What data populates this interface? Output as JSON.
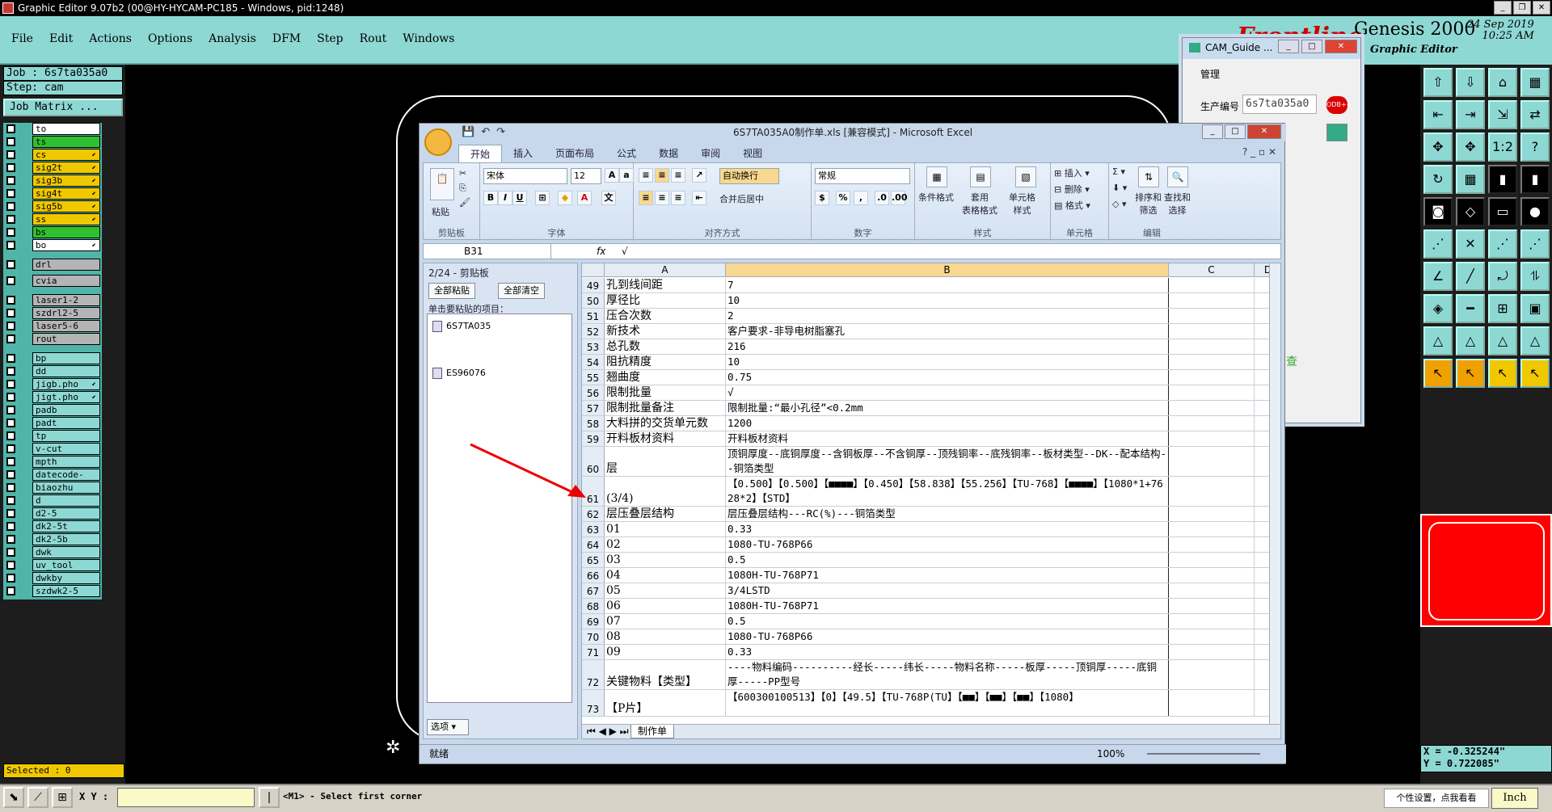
{
  "window": {
    "title": "Graphic Editor 9.07b2 (00@HY-HYCAM-PC185 - Windows, pid:1248)"
  },
  "menu": [
    "File",
    "Edit",
    "Actions",
    "Options",
    "Analysis",
    "DFM",
    "Step",
    "Rout",
    "Windows"
  ],
  "brand": {
    "frontline": "Frontline",
    "product": "Genesis 2000",
    "subtitle": "Graphic Editor",
    "date": "24 Sep 2019",
    "time": "10:25 AM"
  },
  "job": {
    "job_label": "Job : 6s7ta035a0",
    "step_label": "Step: cam",
    "matrix_button": "Job Matrix ..."
  },
  "layers": [
    {
      "name": "to",
      "color": "white",
      "arrow": ""
    },
    {
      "name": "ts",
      "color": "green",
      "arrow": ""
    },
    {
      "name": "cs",
      "color": "yellow",
      "arrow": "⬋"
    },
    {
      "name": "sig2t",
      "color": "yellow",
      "arrow": "⬋"
    },
    {
      "name": "sig3b",
      "color": "yellow",
      "arrow": "⬋"
    },
    {
      "name": "sig4t",
      "color": "yellow",
      "arrow": "⬋"
    },
    {
      "name": "sig5b",
      "color": "yellow",
      "arrow": "⬋"
    },
    {
      "name": "ss",
      "color": "yellow",
      "arrow": "⬋"
    },
    {
      "name": "bs",
      "color": "green",
      "arrow": ""
    },
    {
      "name": "bo",
      "color": "white",
      "arrow": "⬋"
    },
    {
      "name": "drl",
      "color": "grey",
      "arrow": ""
    },
    {
      "name": "cvia",
      "color": "grey",
      "arrow": ""
    },
    {
      "name": "laser1-2",
      "color": "grey",
      "arrow": ""
    },
    {
      "name": "szdrl2-5",
      "color": "grey",
      "arrow": ""
    },
    {
      "name": "laser5-6",
      "color": "grey",
      "arrow": ""
    },
    {
      "name": "rout",
      "color": "grey",
      "arrow": ""
    },
    {
      "name": "bp",
      "color": "teal",
      "arrow": ""
    },
    {
      "name": "dd",
      "color": "teal",
      "arrow": ""
    },
    {
      "name": "jigb.pho",
      "color": "teal",
      "arrow": "⬋"
    },
    {
      "name": "jigt.pho",
      "color": "teal",
      "arrow": "⬋"
    },
    {
      "name": "padb",
      "color": "teal",
      "arrow": ""
    },
    {
      "name": "padt",
      "color": "teal",
      "arrow": ""
    },
    {
      "name": "tp",
      "color": "teal",
      "arrow": ""
    },
    {
      "name": "v-cut",
      "color": "teal",
      "arrow": ""
    },
    {
      "name": "mpth",
      "color": "teal",
      "arrow": ""
    },
    {
      "name": "datecode-pte",
      "color": "teal",
      "arrow": ""
    },
    {
      "name": "biaozhu",
      "color": "teal",
      "arrow": ""
    },
    {
      "name": "d",
      "color": "teal",
      "arrow": ""
    },
    {
      "name": "d2-5",
      "color": "teal",
      "arrow": ""
    },
    {
      "name": "dk2-5t",
      "color": "teal",
      "arrow": ""
    },
    {
      "name": "dk2-5b",
      "color": "teal",
      "arrow": ""
    },
    {
      "name": "dwk",
      "color": "teal",
      "arrow": ""
    },
    {
      "name": "uv_tool",
      "color": "teal",
      "arrow": ""
    },
    {
      "name": "dwkby",
      "color": "teal",
      "arrow": ""
    },
    {
      "name": "szdwk2-5",
      "color": "teal",
      "arrow": ""
    }
  ],
  "selected": "Selected : 0",
  "status": {
    "xy_label": "X Y :",
    "xy_value": "",
    "message": "<M1> - Select first corner",
    "tip": "个性设置，点我看看",
    "unit": "Inch"
  },
  "coords": {
    "x": "X = -0.325244\"",
    "y": "Y = 0.722085\""
  },
  "cam_guide": {
    "title": "CAM_Guide ...",
    "manage": "管理",
    "prod_label": "生产编号",
    "prod_value": "6s7ta035a0",
    "check": "查"
  },
  "excel": {
    "title": "6S7TA035A0制作单.xls [兼容模式] - Microsoft Excel",
    "tabs": [
      "开始",
      "插入",
      "页面布局",
      "公式",
      "数据",
      "审阅",
      "视图"
    ],
    "ribbon": {
      "paste": "粘贴",
      "clipboard": "剪贴板",
      "font_name": "宋体",
      "font_size": "12",
      "font_group": "字体",
      "wrap": "自动换行",
      "merge": "合并后居中",
      "align_group": "对齐方式",
      "number_format": "常规",
      "number_group": "数字",
      "cond": "条件格式",
      "table": "套用\n表格格式",
      "cellstyle": "单元格\n样式",
      "style_group": "样式",
      "insert": "插入",
      "delete": "删除",
      "format": "格式",
      "cells_group": "单元格",
      "sort": "排序和\n筛选",
      "find": "查找和\n选择",
      "edit_group": "编辑"
    },
    "name_box": "B31",
    "fx": "fx",
    "formula": "√",
    "clipboard_pane": {
      "header": "2/24 - 剪贴板",
      "paste_all": "全部粘贴",
      "clear_all": "全部清空",
      "hint": "单击要粘贴的项目：",
      "items": [
        "6S7TA035",
        "ES96076"
      ],
      "options": "选项 ▾"
    },
    "columns": [
      "A",
      "B",
      "C",
      "D"
    ],
    "rows": [
      {
        "n": "49",
        "a": "孔到线间距",
        "b": "7",
        "h": 16
      },
      {
        "n": "50",
        "a": "厚径比",
        "b": "10",
        "h": 16
      },
      {
        "n": "51",
        "a": "压合次数",
        "b": "2",
        "h": 16
      },
      {
        "n": "52",
        "a": "新技术",
        "b": "客户要求-非导电树脂塞孔",
        "h": 16
      },
      {
        "n": "53",
        "a": "总孔数",
        "b": "216",
        "h": 16
      },
      {
        "n": "54",
        "a": "阻抗精度",
        "b": "10",
        "h": 16
      },
      {
        "n": "55",
        "a": "翘曲度",
        "b": "0.75",
        "h": 16
      },
      {
        "n": "56",
        "a": "限制批量",
        "b": "√",
        "h": 16
      },
      {
        "n": "57",
        "a": "限制批量备注",
        "b": "限制批量:“最小孔径”<0.2mm",
        "h": 16
      },
      {
        "n": "58",
        "a": "大料拼的交货单元数",
        "b": "1200",
        "h": 16
      },
      {
        "n": "59",
        "a": "开料板材资料",
        "b": "开料板材资料",
        "h": 16
      },
      {
        "n": "60",
        "a": "层",
        "b": "顶铜厚度--底铜厚度--含铜板厚--不含铜厚--顶残铜率--底残铜率--板材类型--DK--配本结构--铜箔类型",
        "h": 34
      },
      {
        "n": "61",
        "a": "(3/4)",
        "b": "【0.500】【0.500】【■■■■】【0.450】【58.838】【55.256】【TU-768】【■■■■】【1080*1+7628*2】【STD】",
        "h": 34
      },
      {
        "n": "62",
        "a": "层压叠层结构",
        "b": "层压叠层结构---RC(%)---铜箔类型",
        "h": 16
      },
      {
        "n": "63",
        "a": "01",
        "b": "0.33",
        "h": 16
      },
      {
        "n": "64",
        "a": "02",
        "b": "1080-TU-768P66",
        "h": 16
      },
      {
        "n": "65",
        "a": "03",
        "b": "0.5",
        "h": 16
      },
      {
        "n": "66",
        "a": "04",
        "b": "1080H-TU-768P71",
        "h": 16
      },
      {
        "n": "67",
        "a": "05",
        "b": "3/4LSTD",
        "h": 16
      },
      {
        "n": "68",
        "a": "06",
        "b": "1080H-TU-768P71",
        "h": 16
      },
      {
        "n": "69",
        "a": "07",
        "b": "0.5",
        "h": 16
      },
      {
        "n": "70",
        "a": "08",
        "b": "1080-TU-768P66",
        "h": 16
      },
      {
        "n": "71",
        "a": "09",
        "b": "0.33",
        "h": 16
      },
      {
        "n": "72",
        "a": "关键物料【类型】",
        "b": "----物料编码----------经长-----纬长-----物料名称-----板厚-----顶铜厚-----底铜厚-----PP型号",
        "h": 34
      },
      {
        "n": "73",
        "a": "【P片】",
        "b": "【600300100513】【0】【49.5】【TU-768P(TU】【■■】【■■】【■■】【1080】",
        "h": 30
      }
    ],
    "sheet_tab": "制作单",
    "status_ready": "就绪",
    "zoom": "100%"
  }
}
